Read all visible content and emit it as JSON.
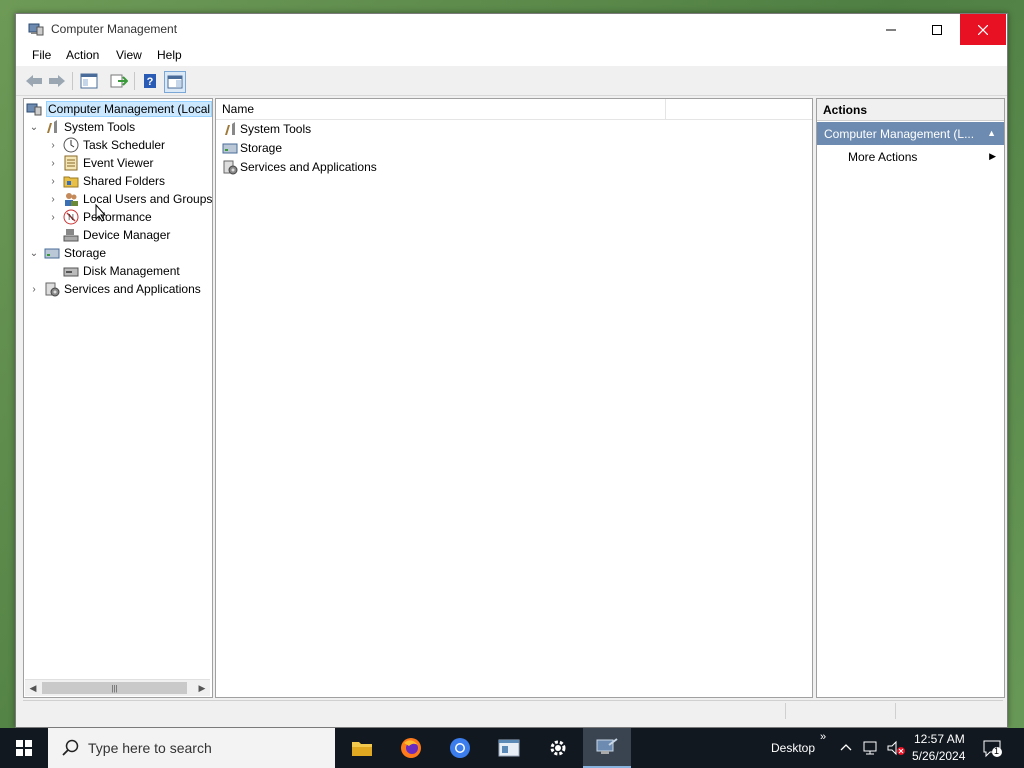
{
  "window": {
    "title": "Computer Management"
  },
  "menubar": {
    "items": [
      "File",
      "Action",
      "View",
      "Help"
    ]
  },
  "tree": {
    "items": [
      {
        "label": "Computer Management (Local",
        "level": 0,
        "expander": "none",
        "icon": "computer-management-icon",
        "selected": true
      },
      {
        "label": "System Tools",
        "level": 1,
        "expander": "expanded",
        "icon": "system-tools-icon"
      },
      {
        "label": "Task Scheduler",
        "level": 2,
        "expander": "collapsed",
        "icon": "clock-icon"
      },
      {
        "label": "Event Viewer",
        "level": 2,
        "expander": "collapsed",
        "icon": "event-viewer-icon"
      },
      {
        "label": "Shared Folders",
        "level": 2,
        "expander": "collapsed",
        "icon": "shared-folder-icon"
      },
      {
        "label": "Local Users and Groups",
        "level": 2,
        "expander": "collapsed",
        "icon": "users-icon"
      },
      {
        "label": "Performance",
        "level": 2,
        "expander": "collapsed",
        "icon": "performance-icon"
      },
      {
        "label": "Device Manager",
        "level": 2,
        "expander": "none",
        "icon": "device-manager-icon"
      },
      {
        "label": "Storage",
        "level": 1,
        "expander": "expanded",
        "icon": "storage-icon"
      },
      {
        "label": "Disk Management",
        "level": 2,
        "expander": "none",
        "icon": "disk-icon"
      },
      {
        "label": "Services and Applications",
        "level": 1,
        "expander": "collapsed",
        "icon": "services-icon"
      }
    ]
  },
  "list": {
    "column_name": "Name",
    "rows": [
      {
        "label": "System Tools",
        "icon": "system-tools-icon"
      },
      {
        "label": "Storage",
        "icon": "storage-icon"
      },
      {
        "label": "Services and Applications",
        "icon": "services-icon"
      }
    ]
  },
  "actions": {
    "header": "Actions",
    "section": "Computer Management (L...",
    "more": "More Actions"
  },
  "taskbar": {
    "search_placeholder": "Type here to search",
    "desktop_label": "Desktop",
    "time": "12:57 AM",
    "date": "5/26/2024",
    "notification_count": "1"
  },
  "colors": {
    "accent_selected": "#cce8ff",
    "actions_section": "#6d8bb0",
    "close_red": "#e81123",
    "taskbar": "#111820"
  }
}
